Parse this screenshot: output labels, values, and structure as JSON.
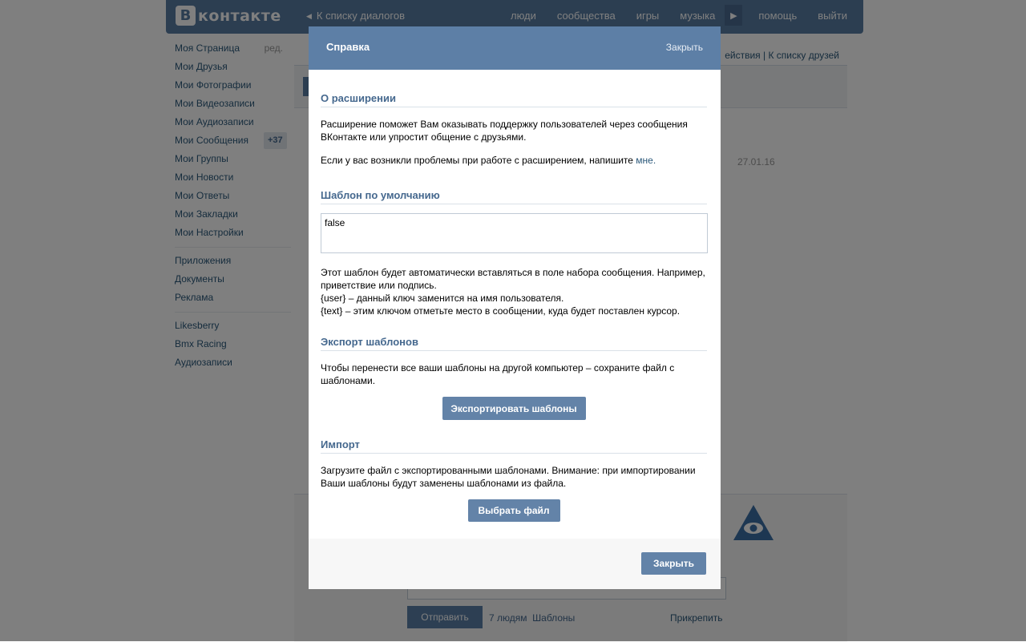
{
  "topbar": {
    "logo_letter": "В",
    "logo_text": "контакте",
    "back_link": "К списку диалогов",
    "nav": [
      "люди",
      "сообщества",
      "игры",
      "музыка"
    ],
    "help": "помощь",
    "logout": "выйти"
  },
  "sidebar": {
    "edit": "ред.",
    "items": [
      {
        "label": "Моя Страница"
      },
      {
        "label": "Мои Друзья"
      },
      {
        "label": "Мои Фотографии"
      },
      {
        "label": "Мои Видеозаписи"
      },
      {
        "label": "Мои Аудиозаписи"
      },
      {
        "label": "Мои Сообщения",
        "badge": "+37"
      },
      {
        "label": "Мои Группы"
      },
      {
        "label": "Мои Новости"
      },
      {
        "label": "Мои Ответы"
      },
      {
        "label": "Мои Закладки"
      },
      {
        "label": "Мои Настройки"
      }
    ],
    "group2": [
      "Приложения",
      "Документы",
      "Реклама"
    ],
    "group3": [
      "Likesberry",
      "Bmx Racing",
      "Аудиозаписи"
    ]
  },
  "content": {
    "links": "ействия | К списку друзей",
    "date": "27.01.16",
    "input_value": "",
    "send_button": "Отправить",
    "people": "7 людям",
    "templates_link": "Шаблоны",
    "attach": "Прикрепить"
  },
  "modal": {
    "title": "Справка",
    "close_top": "Закрыть",
    "about": {
      "heading": "О расширении",
      "text": "Расширение поможет Вам оказывать поддержку пользователей через сообщения ВКонтакте или упростит общение с друзьями.",
      "problems_text": "Если у вас возникли проблемы при работе с расширением, напишите ",
      "problems_link": "мне."
    },
    "default_template": {
      "heading": "Шаблон по умолчанию",
      "value": "false",
      "description": "Этот шаблон будет автоматически вставляться в поле набора сообщения. Например, приветствие или подпись.",
      "key_user": "{user} – данный ключ заменится на имя пользователя.",
      "key_text": "{text} – этим ключом отметьте место в сообщении, куда будет поставлен курсор."
    },
    "export": {
      "heading": "Экспорт шаблонов",
      "text": "Чтобы перенести все ваши шаблоны на другой компьютер – сохраните файл с шаблонами.",
      "button": "Экспортировать шаблоны"
    },
    "import": {
      "heading": "Импорт",
      "text": "Загрузите файл с экспортированными шаблонами. Внимание: при импортировании Ваши шаблоны будут заменены шаблонами из файла.",
      "button": "Выбрать файл"
    },
    "footer_close": "Закрыть"
  },
  "colors": {
    "header_blue": "#5d7fa6",
    "button_blue": "#6383a8",
    "section_title": "#45688e",
    "link": "#2b587a"
  }
}
